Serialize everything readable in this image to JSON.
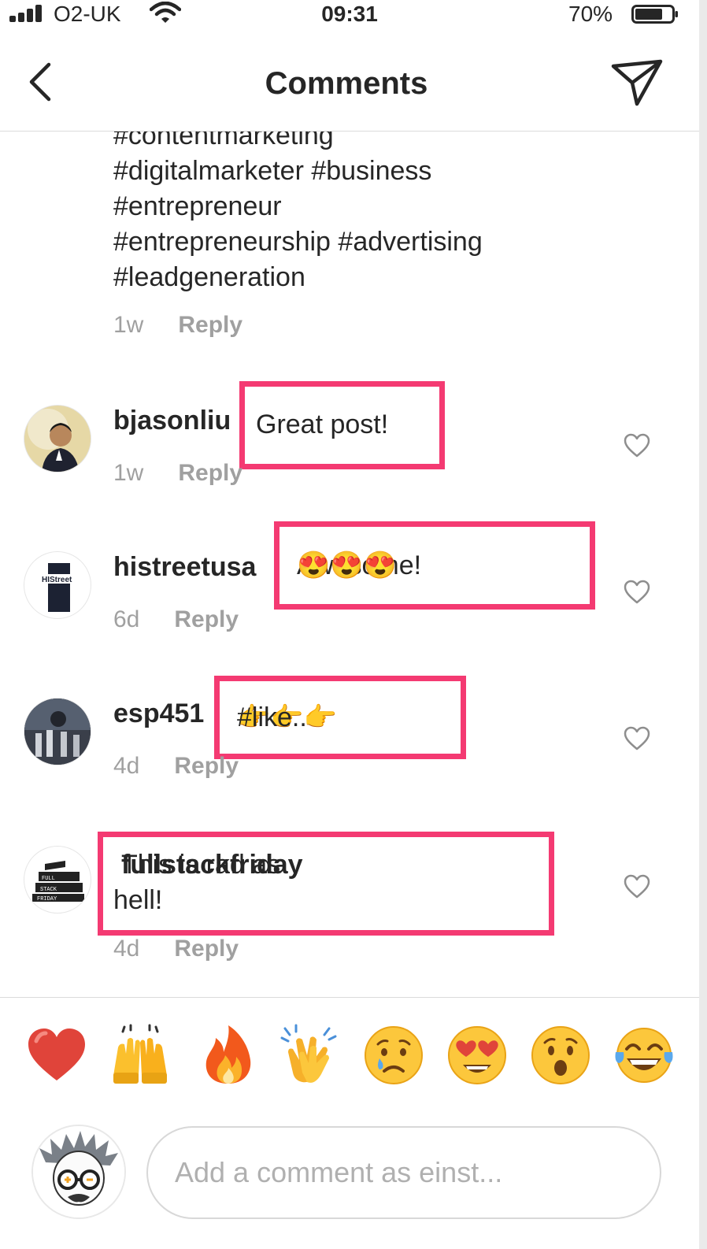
{
  "status_bar": {
    "carrier": "O2-UK",
    "time": "09:31",
    "battery": "70%"
  },
  "nav": {
    "title": "Comments"
  },
  "caption": {
    "lines": [
      "#contentmarketing",
      "#digitalmarketer #business",
      "#entrepreneur",
      "#entrepreneurship #advertising",
      "#leadgeneration"
    ],
    "time": "1w",
    "reply": "Reply"
  },
  "comments": [
    {
      "username": "bjasonliu",
      "text": "Great post!",
      "time": "1w",
      "reply": "Reply"
    },
    {
      "username": "histreetusa",
      "text": "Awesome!",
      "text_emoji": "😍😍😍",
      "time": "6d",
      "reply": "Reply",
      "avatar_label": "HIStreet"
    },
    {
      "username": "esp451",
      "text_emoji": "👉👉👉",
      "text": "#like..",
      "time": "4d",
      "reply": "Reply"
    },
    {
      "username": "fullstackfriday",
      "text_line1": "This is rad as",
      "text_line2": "hell!",
      "time": "4d",
      "reply": "Reply",
      "avatar_label": "FULL STACK FRIDAY"
    }
  ],
  "reactions": [
    {
      "name": "red-heart",
      "glyph": "❤️"
    },
    {
      "name": "raising-hands",
      "glyph": "🙌"
    },
    {
      "name": "fire",
      "glyph": "🔥"
    },
    {
      "name": "clapping-hands",
      "glyph": "👏"
    },
    {
      "name": "crying-face",
      "glyph": "😢"
    },
    {
      "name": "heart-eyes",
      "glyph": "😍"
    },
    {
      "name": "surprised-face",
      "glyph": "😮"
    },
    {
      "name": "tears-of-joy",
      "glyph": "😂"
    }
  ],
  "composer": {
    "placeholder": "Add a comment as einst..."
  },
  "colors": {
    "highlight": "#f43a72",
    "text": "#262626",
    "secondary": "#a0a0a0"
  }
}
